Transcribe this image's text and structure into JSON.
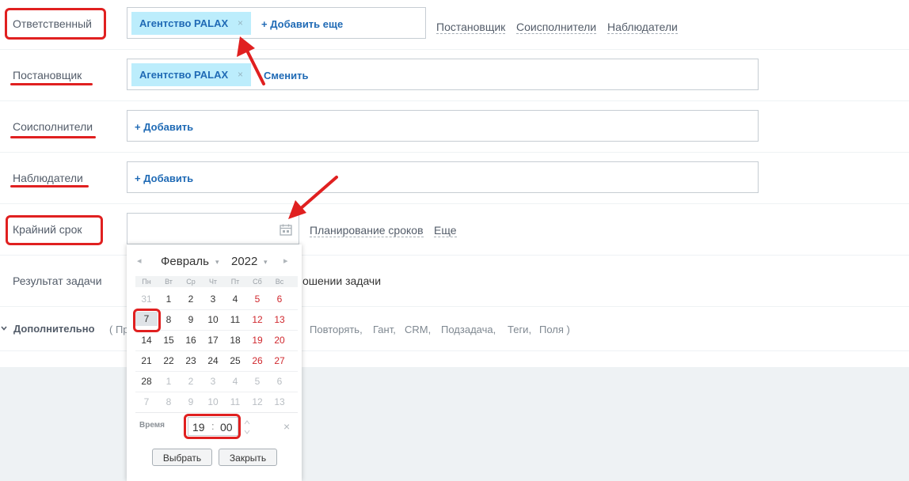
{
  "form": {
    "responsible": {
      "label": "Ответственный",
      "tag": "Агентство PALAX",
      "tag_remove": "×",
      "add": "+ Добавить еще"
    },
    "top_links": [
      "Постановщик",
      "Соисполнители",
      "Наблюдатели"
    ],
    "creator": {
      "label": "Постановщик",
      "tag": "Агентство PALAX",
      "tag_remove": "×",
      "change": "Сменить"
    },
    "coexecutors": {
      "label": "Соисполнители",
      "add": "+ Добавить"
    },
    "observers": {
      "label": "Наблюдатели",
      "add": "+ Добавить"
    },
    "deadline": {
      "label": "Крайний срок",
      "links": [
        "Планирование сроков",
        "Еще"
      ]
    },
    "result": {
      "label": "Результат задачи",
      "text_visible": "ошении задачи"
    },
    "extra": {
      "label": "Дополнительно",
      "open_paren": "( Пр",
      "items": [
        "Повторять,",
        "Гант,",
        "CRM,",
        "Подзадача,",
        "Теги,",
        "Поля )"
      ]
    }
  },
  "calendar": {
    "prev": "◂",
    "next": "▸",
    "month": "Февраль",
    "year": "2022",
    "dropdown": "▾",
    "weekdays": [
      "Пн",
      "Вт",
      "Ср",
      "Чт",
      "Пт",
      "Сб",
      "Вс"
    ],
    "weeks": [
      [
        "31",
        "1",
        "2",
        "3",
        "4",
        "5",
        "6"
      ],
      [
        "7",
        "8",
        "9",
        "10",
        "11",
        "12",
        "13"
      ],
      [
        "14",
        "15",
        "16",
        "17",
        "18",
        "19",
        "20"
      ],
      [
        "21",
        "22",
        "23",
        "24",
        "25",
        "26",
        "27"
      ],
      [
        "28",
        "1",
        "2",
        "3",
        "4",
        "5",
        "6"
      ],
      [
        "7",
        "8",
        "9",
        "10",
        "11",
        "12",
        "13"
      ]
    ],
    "selected_day": "7",
    "time_label": "Время",
    "hours": "19",
    "separator": ":",
    "minutes": "00",
    "clear": "×",
    "select_button": "Выбрать",
    "close_button": "Закрыть"
  },
  "colors": {
    "accent": "#1f6ab5",
    "tag_bg": "#bcedfc",
    "annotation": "#e02020",
    "weekend": "#d0282e",
    "footer_bg": "#eef2f4"
  }
}
